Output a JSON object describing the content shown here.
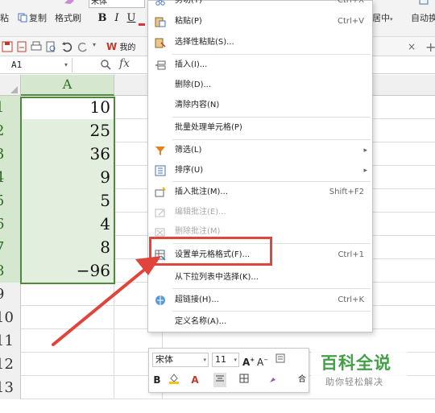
{
  "ribbon": {
    "paste_label": "粘",
    "copy_label": "复制",
    "format_painter_label": "格式刷",
    "font_name": "宋体",
    "bold": "B",
    "italic": "I",
    "underline": "U",
    "merge_center_label": "居中",
    "auto_wrap_label": "自动换"
  },
  "doc_tab": {
    "label": "我的"
  },
  "formula_bar": {
    "cell_ref": "A1",
    "fx": "fx"
  },
  "grid": {
    "column_a": "A",
    "row_numbers": [
      "1",
      "2",
      "3",
      "4",
      "5",
      "6",
      "7",
      "8",
      "9",
      "10",
      "11",
      "12",
      "13"
    ],
    "values": [
      "10",
      "25",
      "36",
      "9",
      "5",
      "4",
      "8",
      "−96"
    ]
  },
  "context_menu": {
    "items": [
      {
        "label": "剪切(T)",
        "shortcut": "Ctrl+X",
        "icon": "scissors-icon"
      },
      {
        "label": "粘贴(P)",
        "shortcut": "Ctrl+V",
        "icon": "paste-icon"
      },
      {
        "label": "选择性粘贴(S)...",
        "shortcut": "",
        "icon": "paste-special-icon"
      },
      {
        "label": "插入(I)...",
        "shortcut": "",
        "icon": "insert-icon"
      },
      {
        "label": "删除(D)...",
        "shortcut": "",
        "icon": ""
      },
      {
        "label": "清除内容(N)",
        "shortcut": "",
        "icon": ""
      },
      {
        "label": "批量处理单元格(P)",
        "shortcut": "",
        "icon": ""
      },
      {
        "label": "筛选(L)",
        "shortcut": "",
        "icon": "filter-icon"
      },
      {
        "label": "排序(U)",
        "shortcut": "",
        "icon": "sort-icon"
      },
      {
        "label": "插入批注(M)...",
        "shortcut": "Shift+F2",
        "icon": "insert-comment-icon"
      },
      {
        "label": "编辑批注(E)...",
        "shortcut": "",
        "icon": "edit-comment-icon"
      },
      {
        "label": "删除批注(M)",
        "shortcut": "",
        "icon": "delete-comment-icon"
      },
      {
        "label": "设置单元格格式(F)...",
        "shortcut": "Ctrl+1",
        "icon": "format-cells-icon"
      },
      {
        "label": "从下拉列表中选择(K)...",
        "shortcut": "",
        "icon": ""
      },
      {
        "label": "超链接(H)...",
        "shortcut": "Ctrl+K",
        "icon": "hyperlink-icon"
      },
      {
        "label": "定义名称(A)...",
        "shortcut": "",
        "icon": ""
      }
    ]
  },
  "mini_toolbar": {
    "font": "宋体",
    "size": "11",
    "bold": "B",
    "font_color_letter": "A",
    "merge_label": "合"
  },
  "watermark": {
    "title": "百科全说",
    "subtitle": "助你轻松解决"
  },
  "colors": {
    "accent_green": "#4f8a3c",
    "highlight_red": "#e0443a",
    "watermark_green": "#43a047"
  }
}
